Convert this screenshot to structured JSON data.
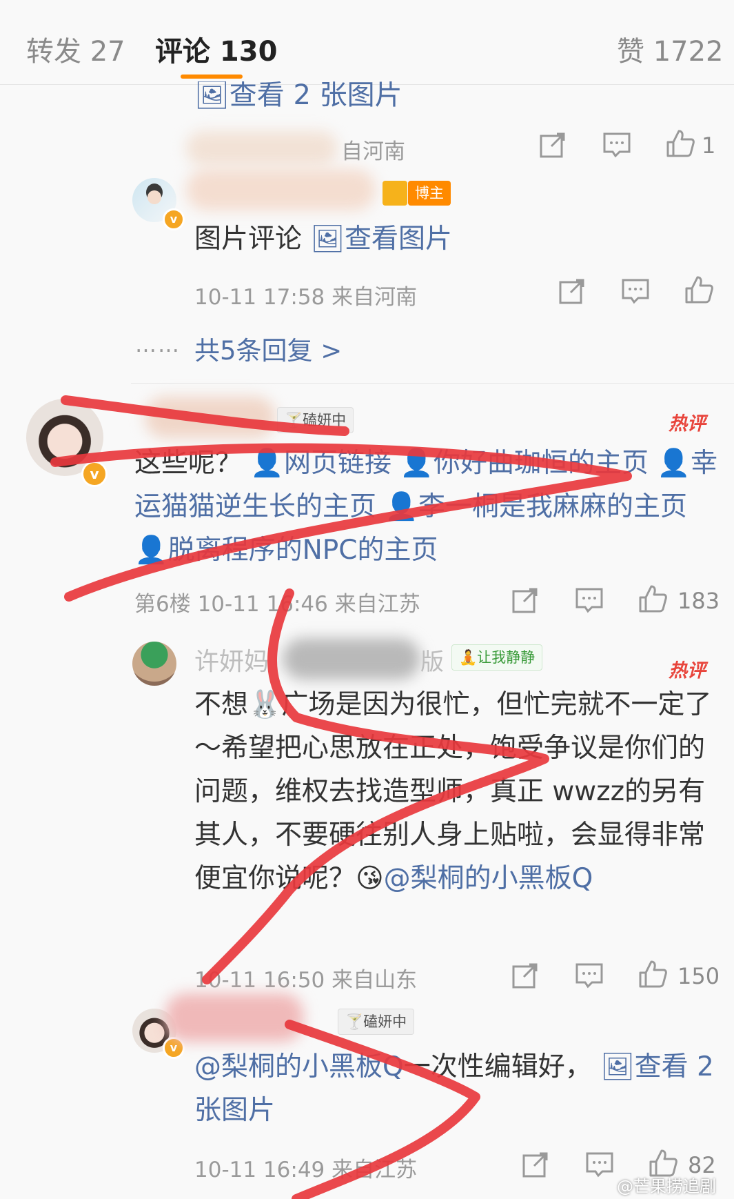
{
  "tabs": {
    "repost": "转发 27",
    "comments": "评论 130",
    "likes": "赞 1722"
  },
  "colors": {
    "accent": "#ff8a00",
    "link": "#4f6fa5",
    "hot": "#e8453c",
    "scribble": "#e8383d"
  },
  "top_remnant": {
    "view_images": "查看 2 张图片",
    "from": "自河南",
    "like_count": "1"
  },
  "reply1": {
    "badge": "博主",
    "text_plain": "图片评论",
    "view_image": "查看图片",
    "meta": "10-11 17:58  来自河南"
  },
  "more_replies": {
    "dots": "……",
    "label": "共5条回复 >"
  },
  "comment_main": {
    "tag": "磕妍中",
    "hot": "热评",
    "line1_start": "这些呢？",
    "link1": "网页链接",
    "link2": "你好曲珈恒的主页",
    "link3": "幸运猫猫逆生长的主页",
    "link4": "李一桐是我麻麻的主页",
    "link5": "脱离程序的NPC的主页",
    "meta": "第6楼 10-11 16:46 来自江苏",
    "like_count": "183"
  },
  "comment_sub1": {
    "name_partial": "许妍妈",
    "name_end": "版",
    "tag": "让我静静",
    "hot": "热评",
    "text": "不想🐰广场是因为很忙，但忙完就不一定了～希望把心思放在正处，饱受争议是你们的问题，维权去找造型师，真正 wwzz的另有其人，不要硬往别人身上贴啦，会显得非常便宜你说呢？😘",
    "mention": "@梨桐的小黑板Q",
    "meta": "10-11 16:50  来自山东",
    "like_count": "150"
  },
  "comment_sub2": {
    "tag": "磕妍中",
    "mention": "@梨桐的小黑板Q",
    "text": "一次性编辑好，",
    "view_images": "查看 2 张图片",
    "meta": "10-11 16:49  来自江苏",
    "like_count": "82"
  },
  "watermark": "@芒果捞追剧"
}
